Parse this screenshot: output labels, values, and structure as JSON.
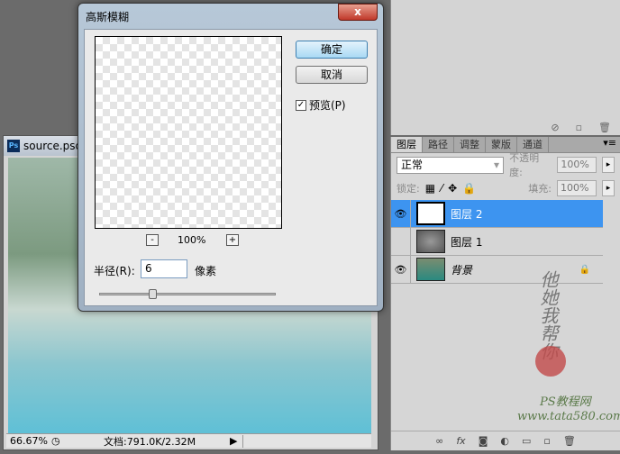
{
  "dialog": {
    "title": "高斯模糊",
    "close_label": "x",
    "ok_label": "确定",
    "cancel_label": "取消",
    "preview_label": "预览(P)",
    "preview_checked": true,
    "zoom_out": "-",
    "zoom_in": "+",
    "zoom_level": "100%",
    "radius_label": "半径(R):",
    "radius_value": "6",
    "radius_unit": "像素",
    "radius_slider_fraction": 0.25
  },
  "document": {
    "title": "source.psd",
    "ps_icon": "Ps",
    "zoom": "66.67%",
    "doc_info": "文档:791.0K/2.32M"
  },
  "layers_panel": {
    "tabs": [
      "图层",
      "路径",
      "调整",
      "蒙版",
      "通道"
    ],
    "blend_mode": "正常",
    "opacity_label": "不透明度:",
    "opacity": "100%",
    "lock_label": "锁定:",
    "fill_label": "填充:",
    "fill": "100%",
    "layers": [
      {
        "name": "图层 2",
        "visible": true,
        "selected": true
      },
      {
        "name": "图层 1",
        "visible": false,
        "selected": false
      },
      {
        "name": "背景",
        "visible": true,
        "selected": false,
        "locked": true
      }
    ]
  },
  "watermark": {
    "signature": "他她我帮你",
    "site_name": "PS教程网",
    "url": "www.tata580.com"
  },
  "colors": {
    "selection": "#3d94f0",
    "workspace": "#6b6b6b"
  }
}
